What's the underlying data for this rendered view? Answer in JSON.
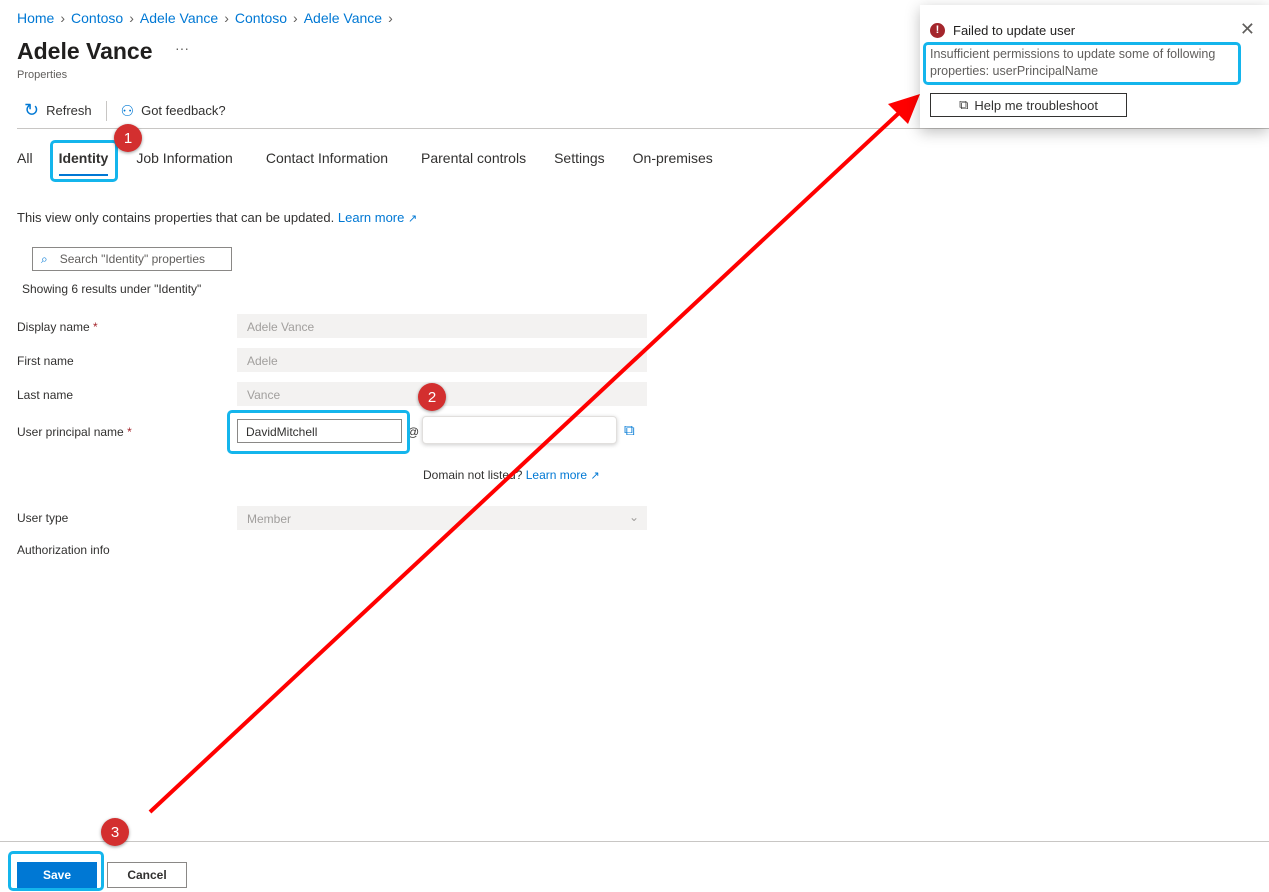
{
  "breadcrumb": [
    "Home",
    "Contoso",
    "Adele Vance",
    "Contoso",
    "Adele Vance"
  ],
  "header": {
    "title": "Adele Vance",
    "more": "···",
    "subtitle": "Properties"
  },
  "toolbar": {
    "refresh": "Refresh",
    "feedback": "Got feedback?"
  },
  "tabs": [
    "All",
    "Identity",
    "Job Information",
    "Contact Information",
    "Parental controls",
    "Settings",
    "On-premises"
  ],
  "info": {
    "text": "This view only contains properties that can be updated.",
    "link": "Learn more"
  },
  "search": {
    "placeholder": "Search \"Identity\" properties"
  },
  "showing": "Showing 6 results under \"Identity\"",
  "fields": {
    "display_name": {
      "label": "Display name",
      "value": "Adele Vance"
    },
    "first_name": {
      "label": "First name",
      "value": "Adele"
    },
    "last_name": {
      "label": "Last name",
      "value": "Vance"
    },
    "upn": {
      "label": "User principal name",
      "value": "DavidMitchell",
      "at": "@",
      "domain": ""
    },
    "domain_note": "Domain not listed?",
    "domain_link": "Learn more",
    "user_type": {
      "label": "User type",
      "value": "Member"
    },
    "auth": {
      "label": "Authorization info"
    },
    "required": "*"
  },
  "toast": {
    "title": "Failed to update user",
    "message": "Insufficient permissions to update some of following properties: userPrincipalName",
    "button": "Help me troubleshoot"
  },
  "footer": {
    "save": "Save",
    "cancel": "Cancel"
  },
  "badges": [
    "1",
    "2",
    "3"
  ],
  "colors": {
    "accent": "#0078d4",
    "highlight": "#14b5ec",
    "arrow": "#ff0000",
    "error": "#a4262c"
  }
}
